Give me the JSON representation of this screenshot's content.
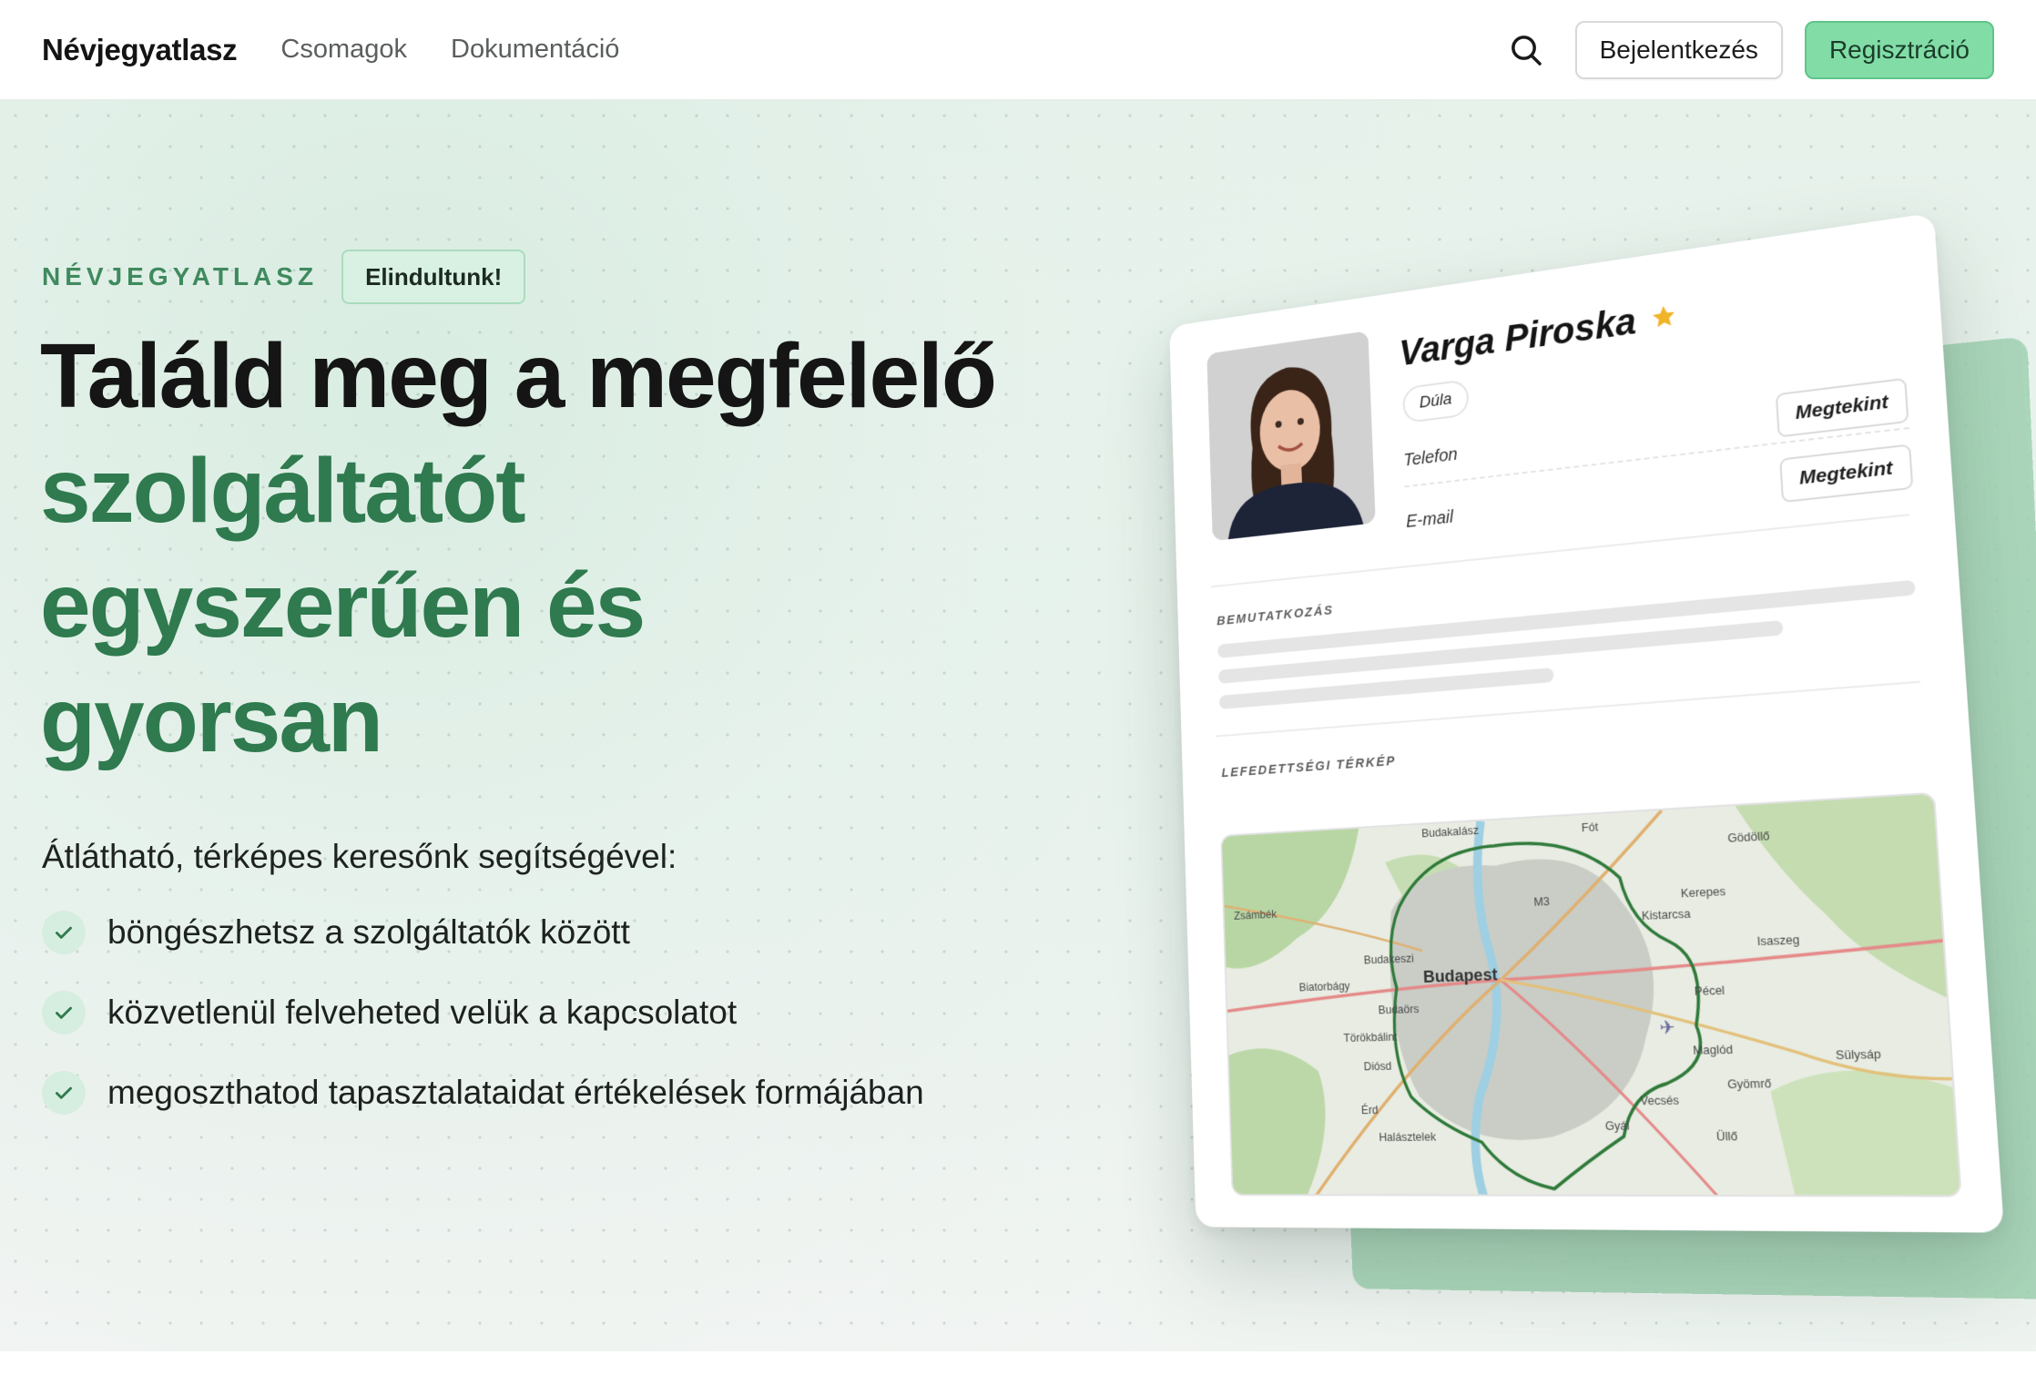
{
  "nav": {
    "brand": "Névjegyatlasz",
    "links": [
      "Csomagok",
      "Dokumentáció"
    ],
    "search_icon": "search-icon",
    "login_label": "Bejelentkezés",
    "register_label": "Regisztráció"
  },
  "hero": {
    "eyebrow": "NÉVJEGYATLASZ",
    "badge": "Elindultunk!",
    "headline_dark": "Találd meg a megfelelő",
    "headline_green": [
      "szolgáltatót",
      "egyszerűen és",
      "gyorsan"
    ],
    "lead": "Átlátható, térképes keresőnk segítségével:",
    "features": [
      "böngészhetsz a szolgáltatók között",
      "közvetlenül felveheted velük a kapcsolatot",
      "megoszthatod tapasztalataidat értékelések formájában"
    ]
  },
  "profile_card": {
    "name": "Varga Piroska",
    "star_icon": "star-icon",
    "role": "Dúla",
    "phone_label": "Telefon",
    "email_label": "E-mail",
    "reveal_label": "Megtekint",
    "intro_label": "BEMUTATKOZÁS",
    "map_label": "LEFEDETTSÉGI TÉRKÉP",
    "map_places": [
      "Budakalász",
      "Fót",
      "Gödöllő",
      "Zsámbék",
      "M3",
      "Kerepes",
      "Kistarcsa",
      "Budakeszi",
      "Budapest",
      "Isaszeg",
      "Biatorbágy",
      "Budaörs",
      "Pécel",
      "Törökbálint",
      "Maglód",
      "Sülysáp",
      "Diósd",
      "Gyömrő",
      "Érd",
      "Vecsés",
      "Gyál",
      "Halásztelek",
      "Üllő"
    ]
  },
  "colors": {
    "accent_green": "#2f7a4e",
    "register_bg": "#82dca6",
    "badge_bg": "#d8f1e2",
    "star": "#f0b429"
  }
}
